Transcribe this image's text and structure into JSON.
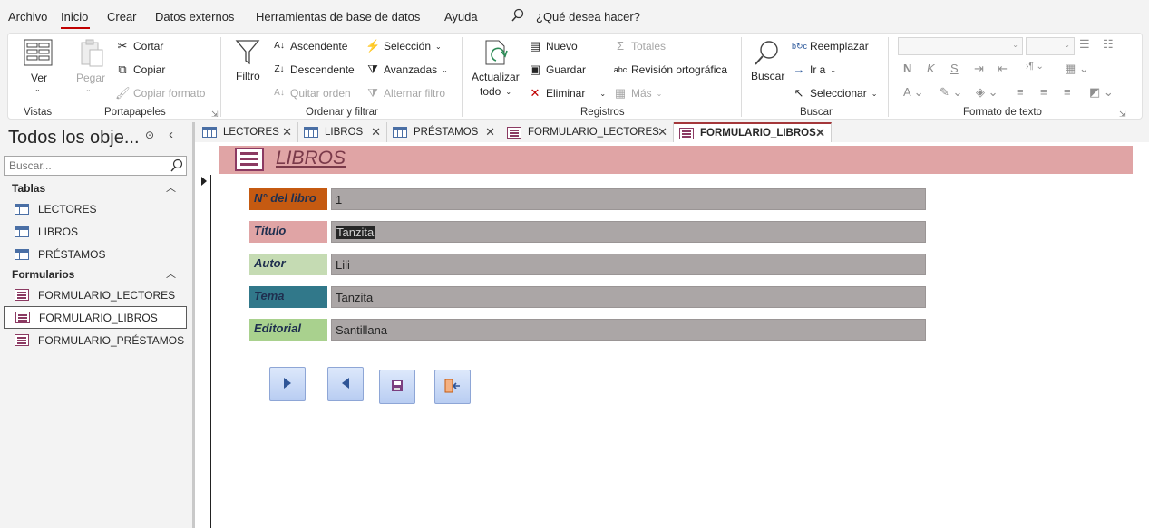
{
  "menubar": {
    "items": [
      "Archivo",
      "Inicio",
      "Crear",
      "Datos externos",
      "Herramientas de base de datos",
      "Ayuda"
    ],
    "active": "Inicio",
    "tell_me": "¿Qué desea hacer?"
  },
  "ribbon": {
    "vistas": {
      "label": "Vistas",
      "ver": "Ver"
    },
    "portapapeles": {
      "label": "Portapapeles",
      "pegar": "Pegar",
      "cortar": "Cortar",
      "copiar": "Copiar",
      "copiar_formato": "Copiar formato"
    },
    "ordenar": {
      "label": "Ordenar y filtrar",
      "filtro": "Filtro",
      "ascendente": "Ascendente",
      "descendente": "Descendente",
      "quitar_orden": "Quitar orden",
      "seleccion": "Selección",
      "avanzadas": "Avanzadas",
      "alternar_filtro": "Alternar filtro"
    },
    "registros": {
      "label": "Registros",
      "actualizar_1": "Actualizar",
      "actualizar_2": "todo",
      "nuevo": "Nuevo",
      "guardar": "Guardar",
      "eliminar": "Eliminar",
      "totales": "Totales",
      "revision": "Revisión ortográfica",
      "mas": "Más"
    },
    "buscar": {
      "label": "Buscar",
      "buscar": "Buscar",
      "reemplazar": "Reemplazar",
      "ir_a": "Ir a",
      "seleccionar": "Seleccionar"
    },
    "formato": {
      "label": "Formato de texto",
      "bold": "N",
      "italic": "K",
      "underline": "S"
    }
  },
  "navpane": {
    "title": "Todos los obje...",
    "search_placeholder": "Buscar...",
    "sections": [
      {
        "name": "Tablas",
        "items": [
          "LECTORES",
          "LIBROS",
          "PRÉSTAMOS"
        ]
      },
      {
        "name": "Formularios",
        "items": [
          "FORMULARIO_LECTORES",
          "FORMULARIO_LIBROS",
          "FORMULARIO_PRÉSTAMOS"
        ]
      }
    ],
    "selected": "FORMULARIO_LIBROS"
  },
  "tabs": [
    {
      "label": "LECTORES",
      "kind": "table"
    },
    {
      "label": "LIBROS",
      "kind": "table"
    },
    {
      "label": "PRÉSTAMOS",
      "kind": "table"
    },
    {
      "label": "FORMULARIO_LECTORES",
      "kind": "form"
    },
    {
      "label": "FORMULARIO_LIBROS",
      "kind": "form",
      "active": true
    }
  ],
  "form": {
    "title": "LIBROS",
    "fields": [
      {
        "label": "N° del libro",
        "value": "1",
        "color": "#c55a11"
      },
      {
        "label": "Título",
        "value": "Tanzita",
        "color": "#e0a4a5",
        "selected": true
      },
      {
        "label": "Autor",
        "value": "Lili",
        "color": "#c5dbb3"
      },
      {
        "label": "Tema",
        "value": "Tanzita",
        "color": "#31788a"
      },
      {
        "label": "Editorial",
        "value": "Santillana",
        "color": "#a9d18e"
      }
    ],
    "buttons": [
      "next-record",
      "previous-record",
      "save-record",
      "close-form"
    ]
  },
  "colors": {
    "accent": "#a4373a",
    "header_band": "#e0a4a5",
    "field_bg": "#aba6a6"
  }
}
